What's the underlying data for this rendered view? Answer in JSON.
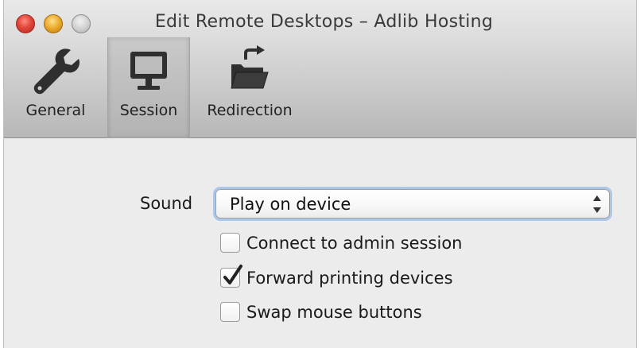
{
  "window": {
    "title": "Edit Remote Desktops – Adlib Hosting"
  },
  "toolbar": {
    "items": [
      {
        "label": "General",
        "icon": "wrench-icon",
        "selected": false
      },
      {
        "label": "Session",
        "icon": "monitor-icon",
        "selected": true
      },
      {
        "label": "Redirection",
        "icon": "folder-redirect-icon",
        "selected": false
      }
    ]
  },
  "session": {
    "sound_label": "Sound",
    "sound_value": "Play on device",
    "options": [
      {
        "label": "Connect to admin session",
        "checked": false
      },
      {
        "label": "Forward printing devices",
        "checked": true
      },
      {
        "label": "Swap mouse buttons",
        "checked": false
      }
    ]
  },
  "colors": {
    "close": "#e0463a",
    "minimize": "#e9a82a",
    "zoom": "#cfcfcf",
    "focus_ring": "#78aae6",
    "icon": "#2f2f2f"
  }
}
